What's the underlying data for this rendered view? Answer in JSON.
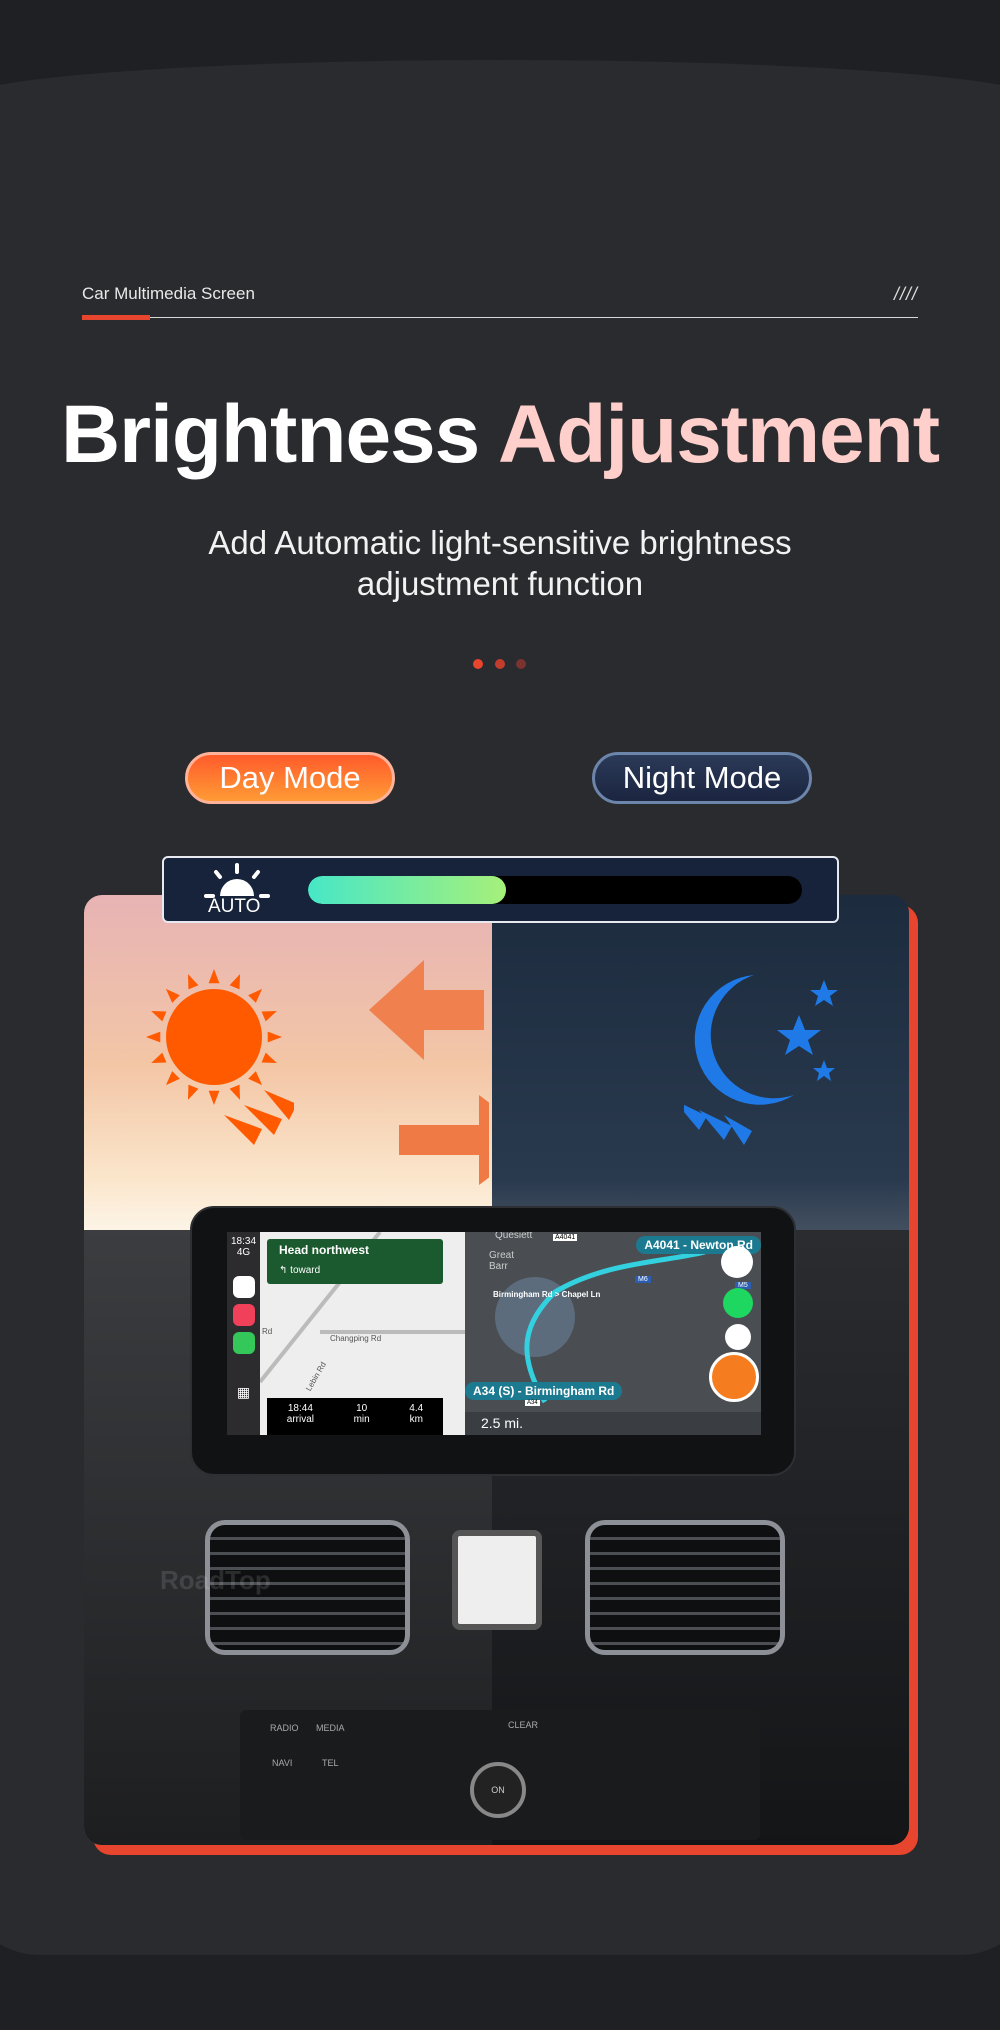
{
  "header": {
    "label": "Car Multimedia Screen",
    "decoration": "////"
  },
  "title": {
    "part1": "Brightness",
    "part2": "Adjustment"
  },
  "subtitle": {
    "line1": "Add Automatic light-sensitive brightness",
    "line2": "adjustment function"
  },
  "pager": {
    "count": 3,
    "active": 0
  },
  "modes": {
    "day": "Day Mode",
    "night": "Night Mode"
  },
  "brightness": {
    "label": "AUTO",
    "level_percent": 40,
    "icon": "auto-brightness-sun-icon"
  },
  "carplay": {
    "time": "18:34",
    "network": "4G",
    "guidance": {
      "direction": "Head northwest",
      "sub": "toward"
    },
    "roads": [
      "Changping Rd",
      "Lebin Rd",
      "Rd"
    ],
    "eta": [
      {
        "value": "18:44",
        "label": "arrival"
      },
      {
        "value": "10",
        "label": "min"
      },
      {
        "value": "4.4",
        "label": "km"
      }
    ],
    "waze": {
      "top_road": "A4041 - Newton Rd",
      "bottom_road": "A34 (S) - Birmingham Rd",
      "route": "Birmingham Rd > Chapel Ln",
      "distance": "2.5 mi.",
      "places": [
        "Quesiett",
        "Great Barr"
      ],
      "badges": [
        "A4041",
        "M6",
        "M5",
        "A34"
      ]
    }
  },
  "dashboard": {
    "buttons": [
      "RADIO",
      "MEDIA",
      "NAVI",
      "TEL",
      "CLEAR",
      "ON"
    ],
    "watermark": "RoadTop"
  },
  "colors": {
    "accent": "#e8452f",
    "title_highlight": "#ffcfcb",
    "day": "#ff7a30",
    "night": "#1f2b48",
    "bar_fill": "#5ee8b5"
  }
}
